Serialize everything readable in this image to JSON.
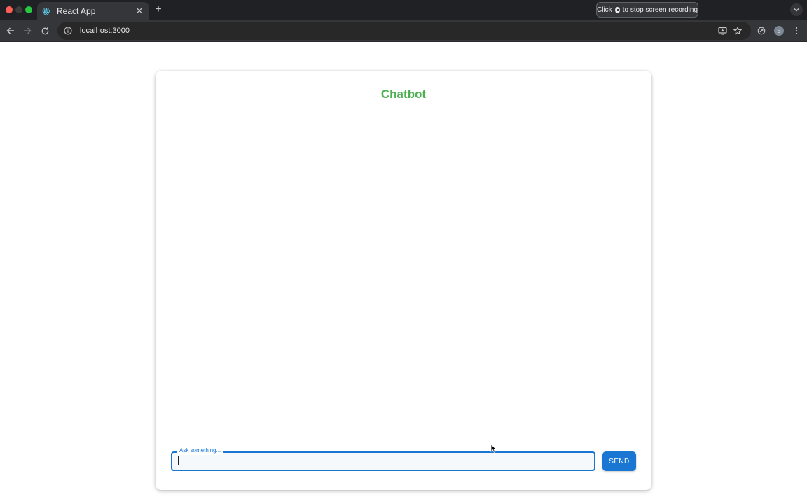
{
  "browser": {
    "tab": {
      "title": "React App",
      "favicon": "react-icon"
    },
    "recording": {
      "prefix": "Click",
      "suffix": "to stop screen recording"
    },
    "address": {
      "url": "localhost:3000"
    },
    "profile_initial": "B"
  },
  "app": {
    "title": "Chatbot",
    "title_color": "#4caf50",
    "accent_color": "#1976d2",
    "input": {
      "label": "Ask something...",
      "value": ""
    },
    "send_label": "SEND"
  }
}
